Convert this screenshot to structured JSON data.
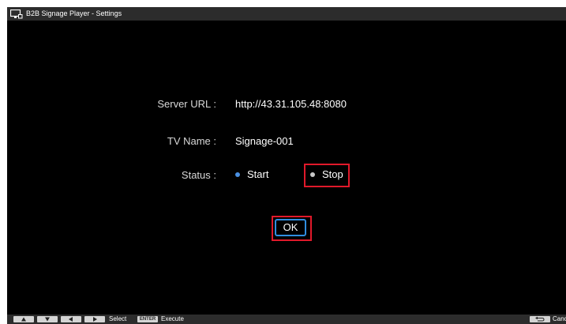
{
  "window": {
    "title": "B2B Signage Player - Settings",
    "icon": "monitor-icon"
  },
  "form": {
    "server_url": {
      "label": "Server URL :",
      "value": "http://43.31.105.48:8080"
    },
    "tv_name": {
      "label": "TV Name :",
      "value": "Signage-001"
    },
    "status": {
      "label": "Status :",
      "options": [
        {
          "label": "Start",
          "selected": true
        },
        {
          "label": "Stop",
          "selected": false
        }
      ]
    },
    "ok_label": "OK"
  },
  "bottom_bar": {
    "keys": [
      "up-arrow-icon",
      "down-arrow-icon",
      "left-arrow-icon",
      "right-arrow-icon"
    ],
    "select_label": "Select",
    "enter_key": "ENTER",
    "execute_label": "Execute",
    "cancel_label": "Canc"
  },
  "colors": {
    "background": "#000000",
    "titlebar": "#2c2c2c",
    "highlight": "#e0192a",
    "focus": "#2f8ee0",
    "selected_radio": "#4a90e2"
  }
}
